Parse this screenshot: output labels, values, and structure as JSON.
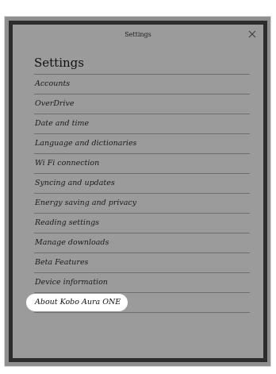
{
  "header": {
    "title": "Settings",
    "close_icon": "close-icon"
  },
  "main": {
    "title": "Settings",
    "items": [
      {
        "label": "Accounts"
      },
      {
        "label": "OverDrive"
      },
      {
        "label": "Date and time"
      },
      {
        "label": "Language and dictionaries"
      },
      {
        "label": "Wi Fi connection"
      },
      {
        "label": "Syncing and updates"
      },
      {
        "label": "Energy saving and privacy"
      },
      {
        "label": "Reading settings"
      },
      {
        "label": "Manage downloads"
      },
      {
        "label": "Beta Features"
      },
      {
        "label": "Device information"
      },
      {
        "label": "About Kobo Aura ONE"
      }
    ],
    "highlighted_item": "About Kobo Aura ONE"
  },
  "colors": {
    "screen_background": "#9b9b9b",
    "frame_border": "#2d2d2d",
    "highlight": "#ffffff"
  }
}
